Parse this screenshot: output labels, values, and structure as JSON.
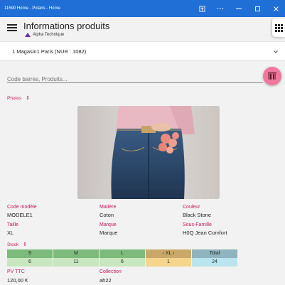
{
  "window": {
    "title": "11590 Home - Polaris - Home"
  },
  "header": {
    "title": "Informations produits",
    "subtitle": "Alpha Technique"
  },
  "store_selector": {
    "value": "1 Magasin1 Paris (NUR : 1082)"
  },
  "search": {
    "placeholder": "Code barres, Produits..."
  },
  "photos": {
    "title": "Photos"
  },
  "details": {
    "code_modele": {
      "label": "Code modèle",
      "value": "MODELE1"
    },
    "matiere": {
      "label": "Matière",
      "value": "Coton"
    },
    "couleur": {
      "label": "Couleur",
      "value": "Black Stone"
    },
    "taille": {
      "label": "Taille",
      "value": "XL"
    },
    "marque": {
      "label": "Marque",
      "value": "Marque"
    },
    "sous_famille": {
      "label": "Sous-Famille",
      "value": "H0Q Jean Comfort"
    }
  },
  "stock": {
    "title": "Stock",
    "columns": [
      {
        "size": "S",
        "qty": "6",
        "head_color": "#7dbb7d",
        "val_color": "#c8e6c0"
      },
      {
        "size": "M",
        "qty": "11",
        "head_color": "#7dbb7d",
        "val_color": "#c8e6c0"
      },
      {
        "size": "L",
        "qty": "6",
        "head_color": "#7dbb7d",
        "val_color": "#c8e6c0"
      },
      {
        "size": "‹ XL ›",
        "qty": "1",
        "head_color": "#c9a86a",
        "val_color": "#f5d58c"
      },
      {
        "size": "Total",
        "qty": "24",
        "head_color": "#8fb4bd",
        "val_color": "#b9e6ee"
      }
    ]
  },
  "prices": {
    "pv_ttc": {
      "label": "PV TTC",
      "value": "120,00 €"
    },
    "collection": {
      "label": "Collection",
      "value": "ah22"
    }
  },
  "colors": {
    "accent": "#c2185b",
    "titlebar": "#1f6fd6",
    "fab": "#f0789d"
  }
}
